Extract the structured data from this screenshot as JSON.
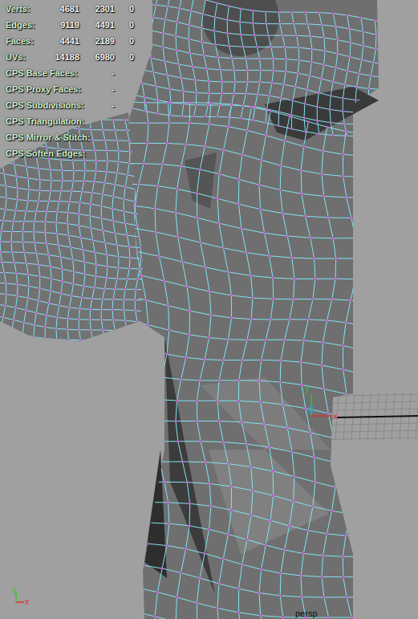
{
  "hud": {
    "stats": [
      {
        "label": "Verts:",
        "values": [
          "4681",
          "2301",
          "0"
        ]
      },
      {
        "label": "Edges:",
        "values": [
          "9119",
          "4491",
          "0"
        ]
      },
      {
        "label": "Faces:",
        "values": [
          "4441",
          "2189",
          "0"
        ]
      },
      {
        "label": "UVs:",
        "values": [
          "14188",
          "6980",
          "0"
        ]
      }
    ],
    "cps": [
      {
        "label": "CPS Base Faces:",
        "value": "-"
      },
      {
        "label": "CPS Proxy Faces:",
        "value": "-"
      },
      {
        "label": "CPS Subdivisions:",
        "value": "-"
      },
      {
        "label": "CPS Triangulation:"
      },
      {
        "label": "CPS Mirror & Stitch:"
      },
      {
        "label": "CPS Soften Edges:"
      }
    ]
  },
  "viewport": {
    "camera": "persp",
    "manipulator": {
      "y": "y",
      "x": "x"
    },
    "view_axis": {
      "y": "y",
      "x": "x"
    }
  }
}
